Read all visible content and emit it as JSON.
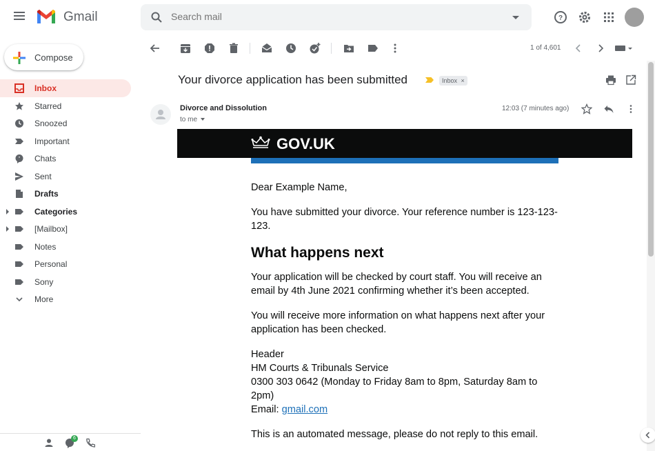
{
  "app": {
    "name": "Gmail"
  },
  "search": {
    "placeholder": "Search mail"
  },
  "compose": {
    "label": "Compose"
  },
  "sidebar": {
    "items": [
      {
        "label": "Inbox",
        "icon": "inbox-icon",
        "active": true
      },
      {
        "label": "Starred",
        "icon": "star-icon"
      },
      {
        "label": "Snoozed",
        "icon": "clock-icon"
      },
      {
        "label": "Important",
        "icon": "important-icon"
      },
      {
        "label": "Chats",
        "icon": "chat-icon"
      },
      {
        "label": "Sent",
        "icon": "send-icon"
      },
      {
        "label": "Drafts",
        "icon": "draft-icon",
        "bold": true
      },
      {
        "label": "Categories",
        "icon": "label-icon",
        "bold": true,
        "expandable": true
      },
      {
        "label": "[Mailbox]",
        "icon": "label-icon",
        "expandable": true
      },
      {
        "label": "Notes",
        "icon": "label-icon"
      },
      {
        "label": "Personal",
        "icon": "label-icon"
      },
      {
        "label": "Sony",
        "icon": "label-icon"
      },
      {
        "label": "More",
        "icon": "chevron-down-icon"
      }
    ],
    "footer_badge": "6"
  },
  "toolbar": {
    "pager": "1 of 4,601"
  },
  "message": {
    "subject": "Your divorce application has been submitted",
    "label_chip": "Inbox",
    "sender": "Divorce and Dissolution",
    "recipient": "to me",
    "timestamp": "12:03 (7 minutes ago)"
  },
  "email": {
    "brand": "GOV.UK",
    "greeting": "Dear Example Name,",
    "para1": "You have submitted your divorce. Your reference number is 123-123-123.",
    "heading": "What happens next",
    "para2": "Your application will be checked by court staff. You will receive an email by 4th June 2021 confirming whether it’s been accepted.",
    "para3": "You will receive more information on what happens next after your application has been checked.",
    "sig_header": "Header",
    "sig_org": "HM Courts & Tribunals Service",
    "sig_phone": "0300 303 0642 (Monday to Friday 8am to 8pm, Saturday 8am to 2pm)",
    "sig_email_label": "Email: ",
    "sig_email_link": "gmail.com",
    "footer_note": "This is an automated message, please do not reply to this email."
  },
  "colors": {
    "accent": "#d93025",
    "govuk_black": "#0b0c0c",
    "govuk_blue": "#1d70b8"
  }
}
